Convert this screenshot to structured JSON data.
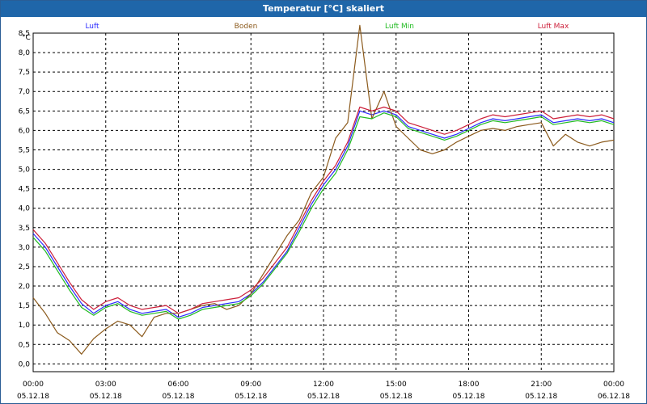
{
  "window": {
    "title": "Temperatur [°C] skaliert"
  },
  "colors": {
    "titlebar": "#1f66a9",
    "luft": "#2a2aff",
    "boden": "#8b5a1c",
    "luft_min": "#22bb22",
    "luft_max": "#cc1f3a",
    "grid": "#000000"
  },
  "chart_data": {
    "type": "line",
    "ylabel": "°C",
    "ylim": [
      0.0,
      8.5
    ],
    "xlim": [
      "00:00",
      "24:00"
    ],
    "grid": true,
    "legend_position": "top",
    "y_ticks": [
      "0,0",
      "0,5",
      "1,0",
      "1,5",
      "2,0",
      "2,5",
      "3,0",
      "3,5",
      "4,0",
      "4,5",
      "5,0",
      "5,5",
      "6,0",
      "6,5",
      "7,0",
      "7,5",
      "8,0",
      "8,5"
    ],
    "x_ticks": [
      {
        "time": "00:00",
        "date": "05.12.18"
      },
      {
        "time": "03:00",
        "date": "05.12.18"
      },
      {
        "time": "06:00",
        "date": "05.12.18"
      },
      {
        "time": "09:00",
        "date": "05.12.18"
      },
      {
        "time": "12:00",
        "date": "05.12.18"
      },
      {
        "time": "15:00",
        "date": "05.12.18"
      },
      {
        "time": "18:00",
        "date": "05.12.18"
      },
      {
        "time": "21:00",
        "date": "05.12.18"
      },
      {
        "time": "00:00",
        "date": "06.12.18"
      }
    ],
    "x_hours": [
      0,
      0.5,
      1,
      1.5,
      2,
      2.5,
      3,
      3.5,
      4,
      4.5,
      5,
      5.5,
      6,
      6.5,
      7,
      7.5,
      8,
      8.5,
      9,
      9.5,
      10,
      10.5,
      11,
      11.5,
      12,
      12.5,
      13,
      13.5,
      14,
      14.5,
      15,
      15.5,
      16,
      16.5,
      17,
      17.5,
      18,
      18.5,
      19,
      19.5,
      20,
      20.5,
      21,
      21.5,
      22,
      22.5,
      23,
      23.5,
      24
    ],
    "series": [
      {
        "name": "Luft",
        "color": "#2a2aff",
        "values": [
          3.35,
          3.0,
          2.5,
          2.0,
          1.55,
          1.3,
          1.5,
          1.6,
          1.4,
          1.3,
          1.35,
          1.4,
          1.2,
          1.3,
          1.45,
          1.5,
          1.55,
          1.6,
          1.8,
          2.1,
          2.5,
          2.9,
          3.5,
          4.1,
          4.6,
          5.0,
          5.6,
          6.5,
          6.4,
          6.5,
          6.4,
          6.1,
          6.0,
          5.9,
          5.8,
          5.9,
          6.05,
          6.2,
          6.3,
          6.25,
          6.3,
          6.35,
          6.4,
          6.2,
          6.25,
          6.3,
          6.25,
          6.3,
          6.2
        ]
      },
      {
        "name": "Boden",
        "color": "#8b5a1c",
        "values": [
          1.7,
          1.3,
          0.8,
          0.6,
          0.25,
          0.65,
          0.9,
          1.1,
          1.0,
          0.7,
          1.2,
          1.3,
          1.3,
          1.4,
          1.5,
          1.55,
          1.4,
          1.5,
          1.8,
          2.3,
          2.8,
          3.3,
          3.7,
          4.4,
          4.8,
          5.8,
          6.2,
          8.7,
          6.3,
          7.0,
          6.1,
          5.8,
          5.5,
          5.4,
          5.5,
          5.7,
          5.85,
          6.0,
          6.05,
          6.0,
          6.1,
          6.15,
          6.2,
          5.6,
          5.9,
          5.7,
          5.6,
          5.7,
          5.75
        ]
      },
      {
        "name": "Luft Min",
        "color": "#22bb22",
        "values": [
          3.25,
          2.9,
          2.4,
          1.9,
          1.45,
          1.25,
          1.45,
          1.55,
          1.35,
          1.25,
          1.3,
          1.35,
          1.15,
          1.25,
          1.4,
          1.45,
          1.5,
          1.55,
          1.75,
          2.05,
          2.45,
          2.85,
          3.4,
          4.0,
          4.5,
          4.9,
          5.5,
          6.35,
          6.3,
          6.45,
          6.35,
          6.05,
          5.95,
          5.85,
          5.75,
          5.85,
          6.0,
          6.15,
          6.25,
          6.2,
          6.25,
          6.3,
          6.35,
          6.15,
          6.2,
          6.25,
          6.2,
          6.25,
          6.15
        ]
      },
      {
        "name": "Luft Max",
        "color": "#cc1f3a",
        "values": [
          3.45,
          3.1,
          2.6,
          2.1,
          1.65,
          1.4,
          1.6,
          1.7,
          1.5,
          1.4,
          1.45,
          1.5,
          1.3,
          1.4,
          1.55,
          1.6,
          1.65,
          1.7,
          1.9,
          2.2,
          2.6,
          3.0,
          3.6,
          4.2,
          4.7,
          5.1,
          5.7,
          6.6,
          6.5,
          6.6,
          6.5,
          6.2,
          6.1,
          6.0,
          5.9,
          6.0,
          6.15,
          6.3,
          6.4,
          6.35,
          6.4,
          6.45,
          6.5,
          6.3,
          6.35,
          6.4,
          6.35,
          6.4,
          6.3
        ]
      }
    ]
  }
}
